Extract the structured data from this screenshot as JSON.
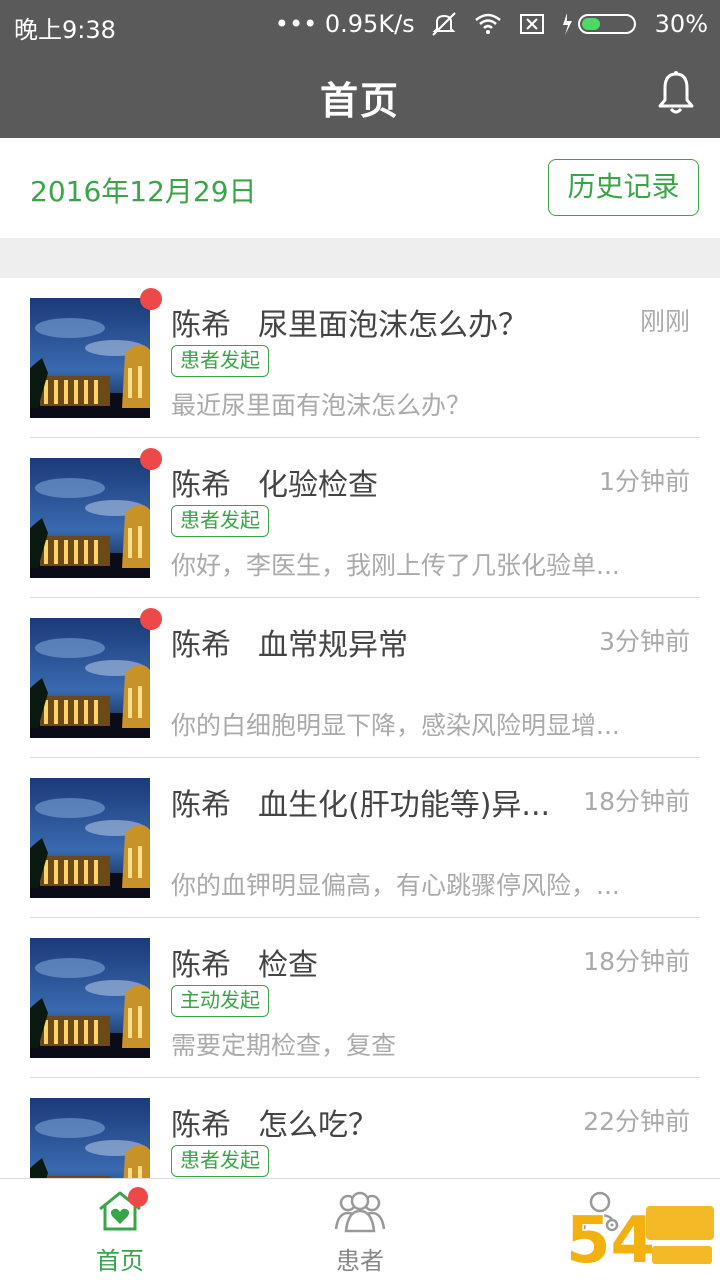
{
  "status_bar": {
    "time": "晚上9:38",
    "network_speed": "0.95K/s",
    "battery": "30%"
  },
  "header": {
    "title": "首页",
    "bell_icon": "bell-icon"
  },
  "date_bar": {
    "date": "2016年12月29日",
    "history_button": "历史记录"
  },
  "messages": [
    {
      "name": "陈希",
      "subject": "尿里面泡沫怎么办？",
      "time": "刚刚",
      "tag": "患者发起",
      "preview": "最近尿里面有泡沫怎么办？",
      "unread": true
    },
    {
      "name": "陈希",
      "subject": "化验检查",
      "time": "1分钟前",
      "tag": "患者发起",
      "preview": "你好，李医生，我刚上传了几张化验单...",
      "unread": true
    },
    {
      "name": "陈希",
      "subject": "血常规异常",
      "time": "3分钟前",
      "tag": "",
      "preview": "你的白细胞明显下降，感染风险明显增...",
      "unread": true
    },
    {
      "name": "陈希",
      "subject": "血生化(肝功能等)异...",
      "time": "18分钟前",
      "tag": "",
      "preview": "你的血钾明显偏高，有心跳骤停风险，...",
      "unread": false
    },
    {
      "name": "陈希",
      "subject": "检查",
      "time": "18分钟前",
      "tag": "主动发起",
      "preview": "需要定期检查，复查",
      "unread": false
    },
    {
      "name": "陈希",
      "subject": "怎么吃？",
      "time": "22分钟前",
      "tag": "患者发起",
      "preview": "",
      "unread": false
    }
  ],
  "tab_bar": {
    "tabs": [
      {
        "label": "首页",
        "icon": "home-heart-icon",
        "active": true
      },
      {
        "label": "患者",
        "icon": "patients-icon",
        "active": false
      },
      {
        "label": "",
        "icon": "profile-settings-icon",
        "active": false
      }
    ]
  },
  "colors": {
    "accent": "#3aa548",
    "header_bg": "#5a5a5a",
    "unread_dot": "#ee4848",
    "muted_text": "#aaaaaa"
  }
}
